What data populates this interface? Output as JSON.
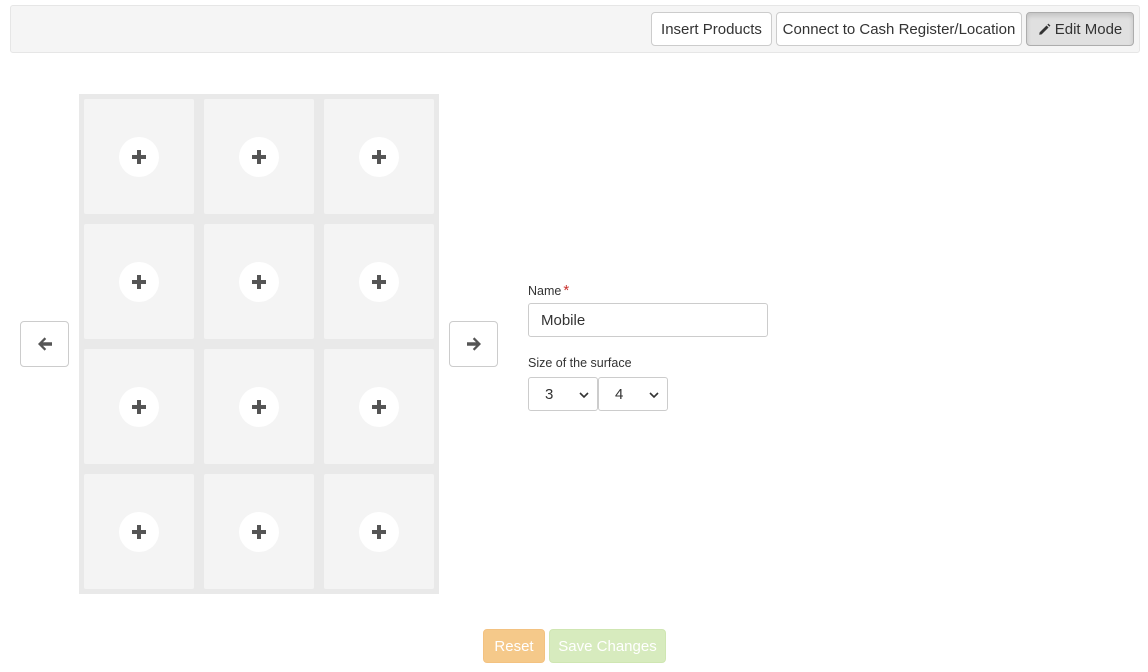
{
  "toolbar": {
    "insert_label": "Insert Products",
    "connect_label": "Connect to Cash Register/Location",
    "edit_label": "Edit Mode"
  },
  "grid": {
    "columns": 3,
    "rows": 4,
    "cell_icon": "plus-icon"
  },
  "nav": {
    "prev_icon": "arrow-left-icon",
    "next_icon": "arrow-right-icon"
  },
  "form": {
    "name_label": "Name",
    "required_mark": "*",
    "name_value": "Mobile",
    "size_label": "Size of the surface",
    "size_cols_value": "3",
    "size_rows_value": "4"
  },
  "actions": {
    "reset_label": "Reset",
    "save_label": "Save Changes"
  },
  "colors": {
    "required": "#c9302c",
    "reset_bg": "#f5c98a",
    "save_bg": "#d7ebbe"
  }
}
